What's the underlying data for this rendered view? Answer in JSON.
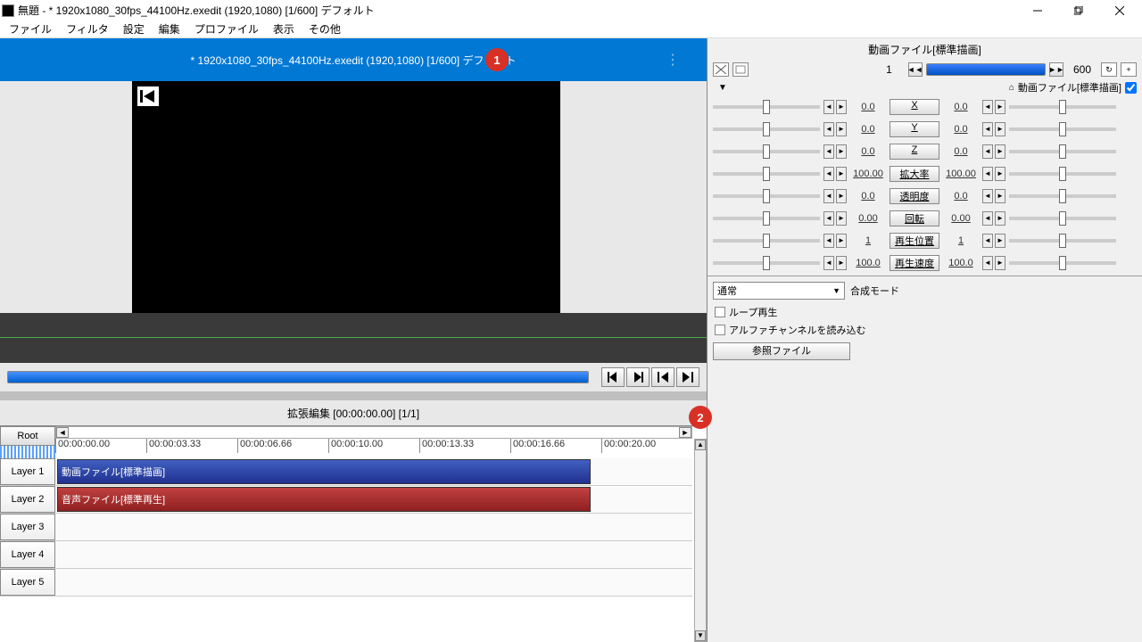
{
  "title": "無題 - * 1920x1080_30fps_44100Hz.exedit (1920,1080)  [1/600]  デフォルト",
  "menu": [
    "ファイル",
    "フィルタ",
    "設定",
    "編集",
    "プロファイル",
    "表示",
    "その他"
  ],
  "bluebar": "* 1920x1080_30fps_44100Hz.exedit (1920,1080)  [1/600]  デフォルト",
  "badge1": "1",
  "badge2": "2",
  "tlheader": "拡張編集 [00:00:00.00] [1/1]",
  "root": "Root",
  "ruler": [
    "00:00:00.00",
    "00:00:03.33",
    "00:00:06.66",
    "00:00:10.00",
    "00:00:13.33",
    "00:00:16.66",
    "00:00:20.00"
  ],
  "layers": [
    "Layer 1",
    "Layer 2",
    "Layer 3",
    "Layer 4",
    "Layer 5"
  ],
  "clipV": "動画ファイル[標準描画]",
  "clipA": "音声ファイル[標準再生]",
  "panelTitle": "動画ファイル[標準描画]",
  "frame": {
    "cur": "1",
    "total": "600"
  },
  "toggleLabel": "動画ファイル[標準描画]",
  "params": [
    {
      "l": "0.0",
      "b": "X",
      "r": "0.0"
    },
    {
      "l": "0.0",
      "b": "Y",
      "r": "0.0"
    },
    {
      "l": "0.0",
      "b": "Z",
      "r": "0.0"
    },
    {
      "l": "100.00",
      "b": "拡大率",
      "r": "100.00"
    },
    {
      "l": "0.0",
      "b": "透明度",
      "r": "0.0"
    },
    {
      "l": "0.00",
      "b": "回転",
      "r": "0.00"
    },
    {
      "l": "1",
      "b": "再生位置",
      "r": "1"
    },
    {
      "l": "100.0",
      "b": "再生速度",
      "r": "100.0"
    }
  ],
  "blend": "通常",
  "blendLabel": "合成モード",
  "chk1": "ループ再生",
  "chk2": "アルファチャンネルを読み込む",
  "ref": "参照ファイル"
}
